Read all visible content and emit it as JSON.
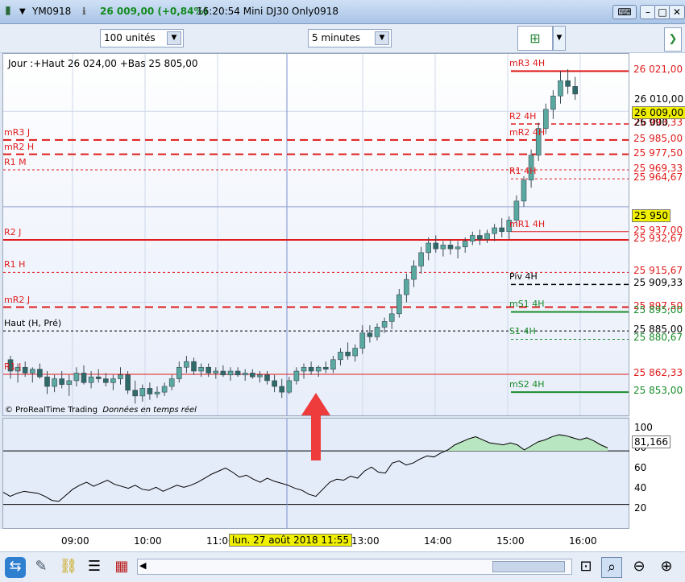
{
  "titlebar": {
    "symbol": "YM0918",
    "change": "26 009,00 (+0,84%)",
    "time_title": "16:20:54 Mini DJ30 Only0918"
  },
  "toolbar": {
    "units": "100 unités",
    "interval": "5 minutes"
  },
  "header": {
    "day_info": "Jour :+Haut 26 024,00 +Bas 25 805,00",
    "credit": "© ProRealTime Trading",
    "credit_note": "Données en temps réel"
  },
  "colors": {
    "red": "#e01b1b",
    "green": "#1a8c2a",
    "candle_up": "#5aa9a0",
    "candle_down": "#2f6a68",
    "grid": "#cfd8ea",
    "accent_label": "#f0f000"
  },
  "chart_data": {
    "type": "candlestick",
    "ylim": [
      25840,
      26030
    ],
    "x_labels": [
      "09:00",
      "10:00",
      "11:00",
      "13:00",
      "14:00",
      "15:00",
      "16:00"
    ],
    "crosshair_time": "lun. 27 août 2018 11:55",
    "crosshair_price": "25 950",
    "last_price": "26 009,00",
    "price_ticks": [
      "26 010,00",
      "26 000"
    ],
    "levels": [
      {
        "name": "mR3 4H",
        "value": 26021,
        "label": "26 021,00",
        "style": "solid",
        "color": "red",
        "side": "right"
      },
      {
        "name": "R2 4H",
        "value": 25993.33,
        "label": "25 993,33",
        "style": "dashed",
        "color": "red",
        "side": "right"
      },
      {
        "name": "mR3 J",
        "value": 25985,
        "label": "25 985,00",
        "style": "dashed-bold",
        "color": "red",
        "side": "left"
      },
      {
        "name": "mR2 4H",
        "value": 25985,
        "label": "",
        "style": "none",
        "color": "red",
        "side": "right"
      },
      {
        "name": "mR2 H",
        "value": 25977.5,
        "label": "25 977,50",
        "style": "dashed-bold",
        "color": "red",
        "side": "left"
      },
      {
        "name": "R1 M",
        "value": 25969.33,
        "label": "25 969,33",
        "style": "dotted",
        "color": "red",
        "side": "left"
      },
      {
        "name": "R1 4H",
        "value": 25964.67,
        "label": "25 964,67",
        "style": "dotted",
        "color": "red",
        "side": "right"
      },
      {
        "name": "mR1 4H",
        "value": 25937,
        "label": "25 937,00",
        "style": "solid-thin",
        "color": "red",
        "side": "right"
      },
      {
        "name": "R2 J",
        "value": 25932.67,
        "label": "25 932,67",
        "style": "solid",
        "color": "red",
        "side": "left"
      },
      {
        "name": "R1 H",
        "value": 25915.67,
        "label": "25 915,67",
        "style": "dotted",
        "color": "red",
        "side": "left"
      },
      {
        "name": "Piv 4H",
        "value": 25909.33,
        "label": "25 909,33",
        "style": "dashed",
        "color": "black",
        "side": "right"
      },
      {
        "name": "mR2 J",
        "value": 25897.5,
        "label": "25 897,50",
        "style": "dashed-bold",
        "color": "red",
        "side": "left"
      },
      {
        "name": "mS1 4H",
        "value": 25895,
        "label": "25 895,00",
        "style": "solid",
        "color": "green",
        "side": "right"
      },
      {
        "name": "Haut (H, Pré)",
        "value": 25885,
        "label": "25 885,00",
        "style": "dotted",
        "color": "black",
        "side": "left"
      },
      {
        "name": "S1 4H",
        "value": 25880.67,
        "label": "25 880,67",
        "style": "dotted",
        "color": "green",
        "side": "right"
      },
      {
        "name": "R1 J",
        "value": 25862.33,
        "label": "25 862,33",
        "style": "solid-thin",
        "color": "red",
        "side": "left"
      },
      {
        "name": "mS2 4H",
        "value": 25853,
        "label": "25 853,00",
        "style": "solid",
        "color": "green",
        "side": "right"
      }
    ],
    "candles": [
      [
        25870,
        25872,
        25860,
        25864
      ],
      [
        25864,
        25868,
        25858,
        25866
      ],
      [
        25866,
        25869,
        25861,
        25863
      ],
      [
        25863,
        25866,
        25858,
        25865
      ],
      [
        25865,
        25868,
        25860,
        25861
      ],
      [
        25861,
        25864,
        25852,
        25856
      ],
      [
        25856,
        25862,
        25853,
        25860
      ],
      [
        25860,
        25864,
        25855,
        25857
      ],
      [
        25857,
        25862,
        25851,
        25859
      ],
      [
        25859,
        25866,
        25856,
        25863
      ],
      [
        25863,
        25867,
        25857,
        25858
      ],
      [
        25858,
        25864,
        25855,
        25861
      ],
      [
        25861,
        25865,
        25858,
        25860
      ],
      [
        25860,
        25863,
        25856,
        25858
      ],
      [
        25858,
        25862,
        25854,
        25860
      ],
      [
        25860,
        25866,
        25857,
        25862
      ],
      [
        25862,
        25864,
        25852,
        25854
      ],
      [
        25854,
        25859,
        25847,
        25851
      ],
      [
        25851,
        25857,
        25848,
        25855
      ],
      [
        25855,
        25858,
        25849,
        25852
      ],
      [
        25852,
        25856,
        25850,
        25853
      ],
      [
        25853,
        25858,
        25851,
        25856
      ],
      [
        25856,
        25862,
        25854,
        25860
      ],
      [
        25860,
        25869,
        25858,
        25866
      ],
      [
        25866,
        25872,
        25863,
        25869
      ],
      [
        25869,
        25871,
        25862,
        25864
      ],
      [
        25864,
        25868,
        25861,
        25866
      ],
      [
        25866,
        25868,
        25861,
        25863
      ],
      [
        25863,
        25866,
        25860,
        25864
      ],
      [
        25864,
        25867,
        25861,
        25862
      ],
      [
        25862,
        25866,
        25859,
        25864
      ],
      [
        25864,
        25866,
        25861,
        25862
      ],
      [
        25862,
        25865,
        25859,
        25863
      ],
      [
        25863,
        25865,
        25860,
        25861
      ],
      [
        25861,
        25864,
        25858,
        25862
      ],
      [
        25862,
        25864,
        25857,
        25859
      ],
      [
        25859,
        25862,
        25853,
        25856
      ],
      [
        25856,
        25860,
        25850,
        25853
      ],
      [
        25853,
        25861,
        25852,
        25859
      ],
      [
        25859,
        25866,
        25857,
        25864
      ],
      [
        25864,
        25868,
        25860,
        25866
      ],
      [
        25866,
        25869,
        25862,
        25864
      ],
      [
        25864,
        25867,
        25861,
        25866
      ],
      [
        25866,
        25869,
        25863,
        25865
      ],
      [
        25865,
        25872,
        25863,
        25870
      ],
      [
        25870,
        25876,
        25867,
        25874
      ],
      [
        25874,
        25879,
        25870,
        25872
      ],
      [
        25872,
        25878,
        25869,
        25876
      ],
      [
        25876,
        25888,
        25873,
        25884
      ],
      [
        25884,
        25888,
        25879,
        25882
      ],
      [
        25882,
        25889,
        25880,
        25887
      ],
      [
        25887,
        25892,
        25884,
        25890
      ],
      [
        25890,
        25897,
        25886,
        25894
      ],
      [
        25894,
        25907,
        25892,
        25904
      ],
      [
        25904,
        25915,
        25900,
        25912
      ],
      [
        25912,
        25922,
        25908,
        25919
      ],
      [
        25919,
        25929,
        25915,
        25926
      ],
      [
        25926,
        25934,
        25922,
        25931
      ],
      [
        25931,
        25935,
        25926,
        25928
      ],
      [
        25928,
        25932,
        25924,
        25930
      ],
      [
        25930,
        25933,
        25925,
        25928
      ],
      [
        25928,
        25932,
        25923,
        25929
      ],
      [
        25929,
        25934,
        25926,
        25932
      ],
      [
        25932,
        25937,
        25930,
        25935
      ],
      [
        25935,
        25938,
        25930,
        25933
      ],
      [
        25933,
        25938,
        25931,
        25936
      ],
      [
        25936,
        25941,
        25932,
        25939
      ],
      [
        25939,
        25944,
        25934,
        25937
      ],
      [
        25937,
        25945,
        25933,
        25943
      ],
      [
        25943,
        25956,
        25940,
        25953
      ],
      [
        25953,
        25966,
        25950,
        25964
      ],
      [
        25964,
        25980,
        25960,
        25977
      ],
      [
        25977,
        25994,
        25974,
        25991
      ],
      [
        25991,
        26004,
        25988,
        26001
      ],
      [
        26001,
        26011,
        25996,
        26008
      ],
      [
        26008,
        26021,
        26004,
        26016
      ],
      [
        26016,
        26022,
        26009,
        26013
      ],
      [
        26013,
        26018,
        26006,
        26009
      ]
    ],
    "oscillator": {
      "ylim": [
        0,
        110
      ],
      "ticks": [
        100,
        80,
        60,
        40,
        20
      ],
      "thresholds": [
        78,
        25
      ],
      "last_value": "81,166",
      "values": [
        37,
        33,
        36,
        38,
        37,
        36,
        33,
        29,
        28,
        34,
        40,
        44,
        47,
        43,
        46,
        49,
        45,
        43,
        41,
        44,
        40,
        39,
        42,
        38,
        41,
        44,
        42,
        44,
        47,
        51,
        55,
        58,
        61,
        57,
        52,
        54,
        50,
        47,
        51,
        48,
        46,
        44,
        41,
        39,
        35,
        33,
        40,
        47,
        50,
        49,
        53,
        51,
        58,
        62,
        57,
        56,
        66,
        68,
        64,
        66,
        70,
        73,
        72,
        76,
        79,
        84,
        87,
        90,
        92,
        89,
        86,
        85,
        84,
        86,
        84,
        79,
        83,
        87,
        89,
        92,
        94,
        93,
        91,
        89,
        91,
        88,
        84,
        81
      ]
    }
  }
}
